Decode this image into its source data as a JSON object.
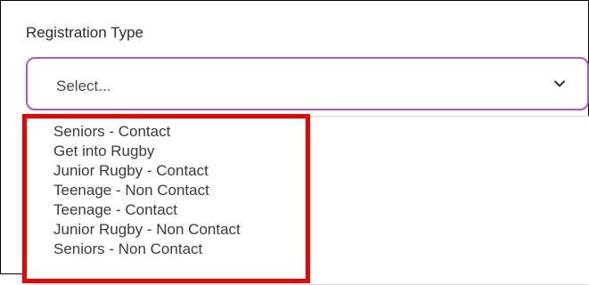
{
  "form": {
    "label": "Registration Type",
    "select": {
      "value": "Select...",
      "icon": "chevron-down-icon"
    },
    "options": [
      "Seniors - Contact",
      "Get into Rugby",
      "Junior Rugby - Contact",
      "Teenage - Non Contact",
      "Teenage - Contact",
      "Junior Rugby - Non Contact",
      "Seniors - Non Contact"
    ]
  },
  "annotation": {
    "color": "#ee0000"
  },
  "colors": {
    "select_border": "#b452d8",
    "text": "#3a3a3a"
  }
}
